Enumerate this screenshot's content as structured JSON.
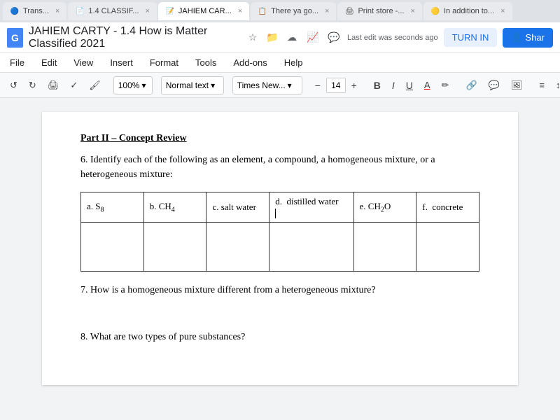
{
  "tabs": [
    {
      "id": "trans",
      "label": "Trans...",
      "favicon": "🔵",
      "active": false
    },
    {
      "id": "classif",
      "label": "1.4 CLASSIF...",
      "favicon": "📄",
      "active": false
    },
    {
      "id": "jahiem",
      "label": "JAHIEM CAR...",
      "favicon": "📝",
      "active": true
    },
    {
      "id": "there",
      "label": "There ya go...",
      "favicon": "📋",
      "active": false
    },
    {
      "id": "print",
      "label": "Print store -...",
      "favicon": "🖨",
      "active": false
    },
    {
      "id": "inaddition",
      "label": "In addition to...",
      "favicon": "🟡",
      "active": false
    }
  ],
  "appbar": {
    "doc_icon_label": "G",
    "doc_title": "JAHIEM CARTY - 1.4 How is Matter Classified 2021",
    "last_edit": "Last edit was seconds ago",
    "turn_in_label": "TURN IN",
    "share_label": "Shar"
  },
  "menubar": {
    "items": [
      "File",
      "Edit",
      "View",
      "Insert",
      "Format",
      "Tools",
      "Add-ons",
      "Help"
    ]
  },
  "toolbar": {
    "undo_label": "↺",
    "redo_label": "↻",
    "paint_label": "🖌",
    "zoom_label": "100%",
    "style_label": "Normal text",
    "font_label": "Times New...",
    "font_size": "14",
    "bold": "B",
    "italic": "I",
    "underline": "U",
    "text_color": "A",
    "highlight": "✏",
    "link": "🔗",
    "comment": "💬",
    "image": "🖼",
    "align": "≡",
    "linespace": "↕",
    "more": "⋯",
    "edit_pencil": "✏"
  },
  "document": {
    "section_title": "Part II – Concept Review",
    "q6_text": "6. Identify each of the following as an element, a compound, a homogeneous mixture, or a heterogeneous mixture:",
    "table_headers": [
      "a. S₈",
      "b. CH₄",
      "c. salt water",
      "d.  distilled water",
      "e. CH₂O",
      "f.  concrete"
    ],
    "q7_text": "7. How is a homogeneous mixture different from a heterogeneous mixture?",
    "q8_text": "8.  What are two types of pure substances?"
  }
}
